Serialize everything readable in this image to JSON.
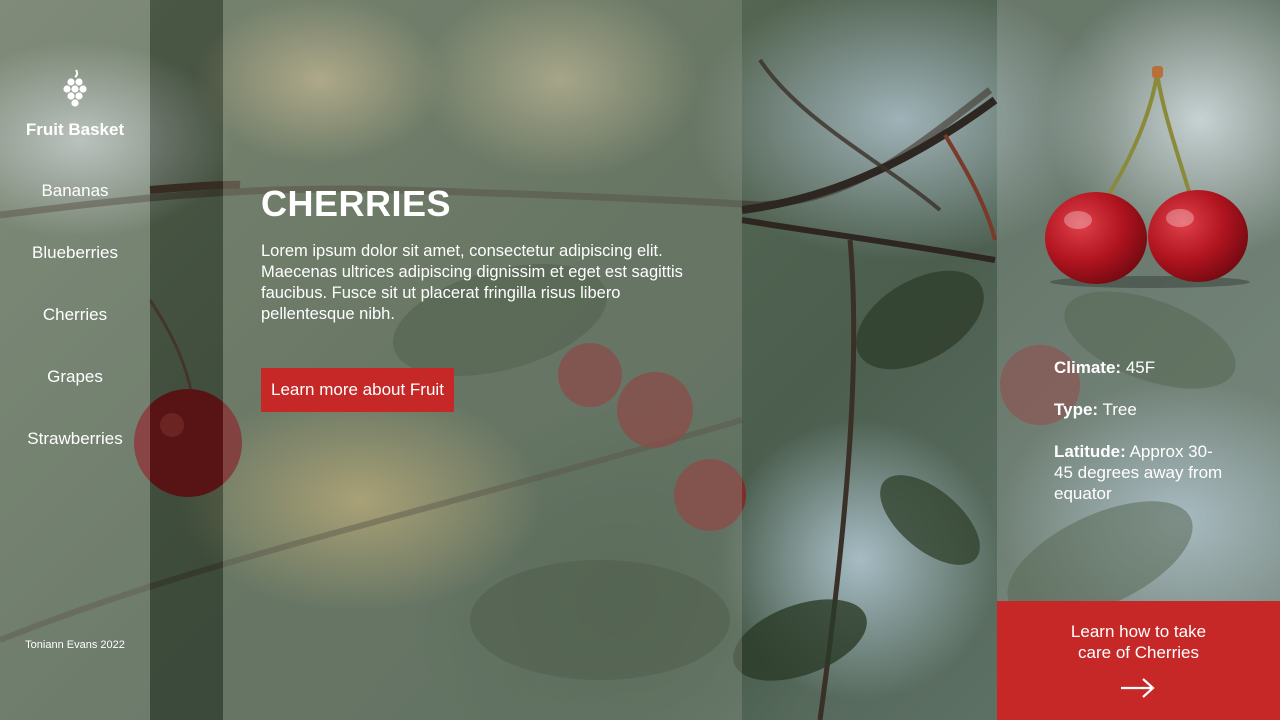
{
  "brand": {
    "name": "Fruit Basket",
    "logo_icon": "grapes-icon"
  },
  "sidebar": {
    "items": [
      {
        "label": "Bananas"
      },
      {
        "label": "Blueberries"
      },
      {
        "label": "Cherries"
      },
      {
        "label": "Grapes"
      },
      {
        "label": "Strawberries"
      }
    ],
    "footer": "Toniann Evans 2022"
  },
  "main": {
    "title": "CHERRIES",
    "description": "Lorem ipsum dolor sit amet, consectetur adipiscing elit. Maecenas ultrices adipiscing dignissim et eget est sagittis faucibus. Fusce sit ut placerat fringilla risus libero pellentesque nibh.",
    "cta_label": "Learn more about Fruit"
  },
  "info": {
    "climate_label": "Climate:",
    "climate_value": "45F",
    "type_label": "Type:",
    "type_value": "Tree",
    "latitude_label": "Latitude:",
    "latitude_value": "Approx 30-45 degrees away from equator"
  },
  "care": {
    "line1": "Learn how to take",
    "line2": "care of Cherries",
    "icon": "arrow-right-icon"
  },
  "colors": {
    "accent": "#c62828",
    "text": "#ffffff"
  }
}
